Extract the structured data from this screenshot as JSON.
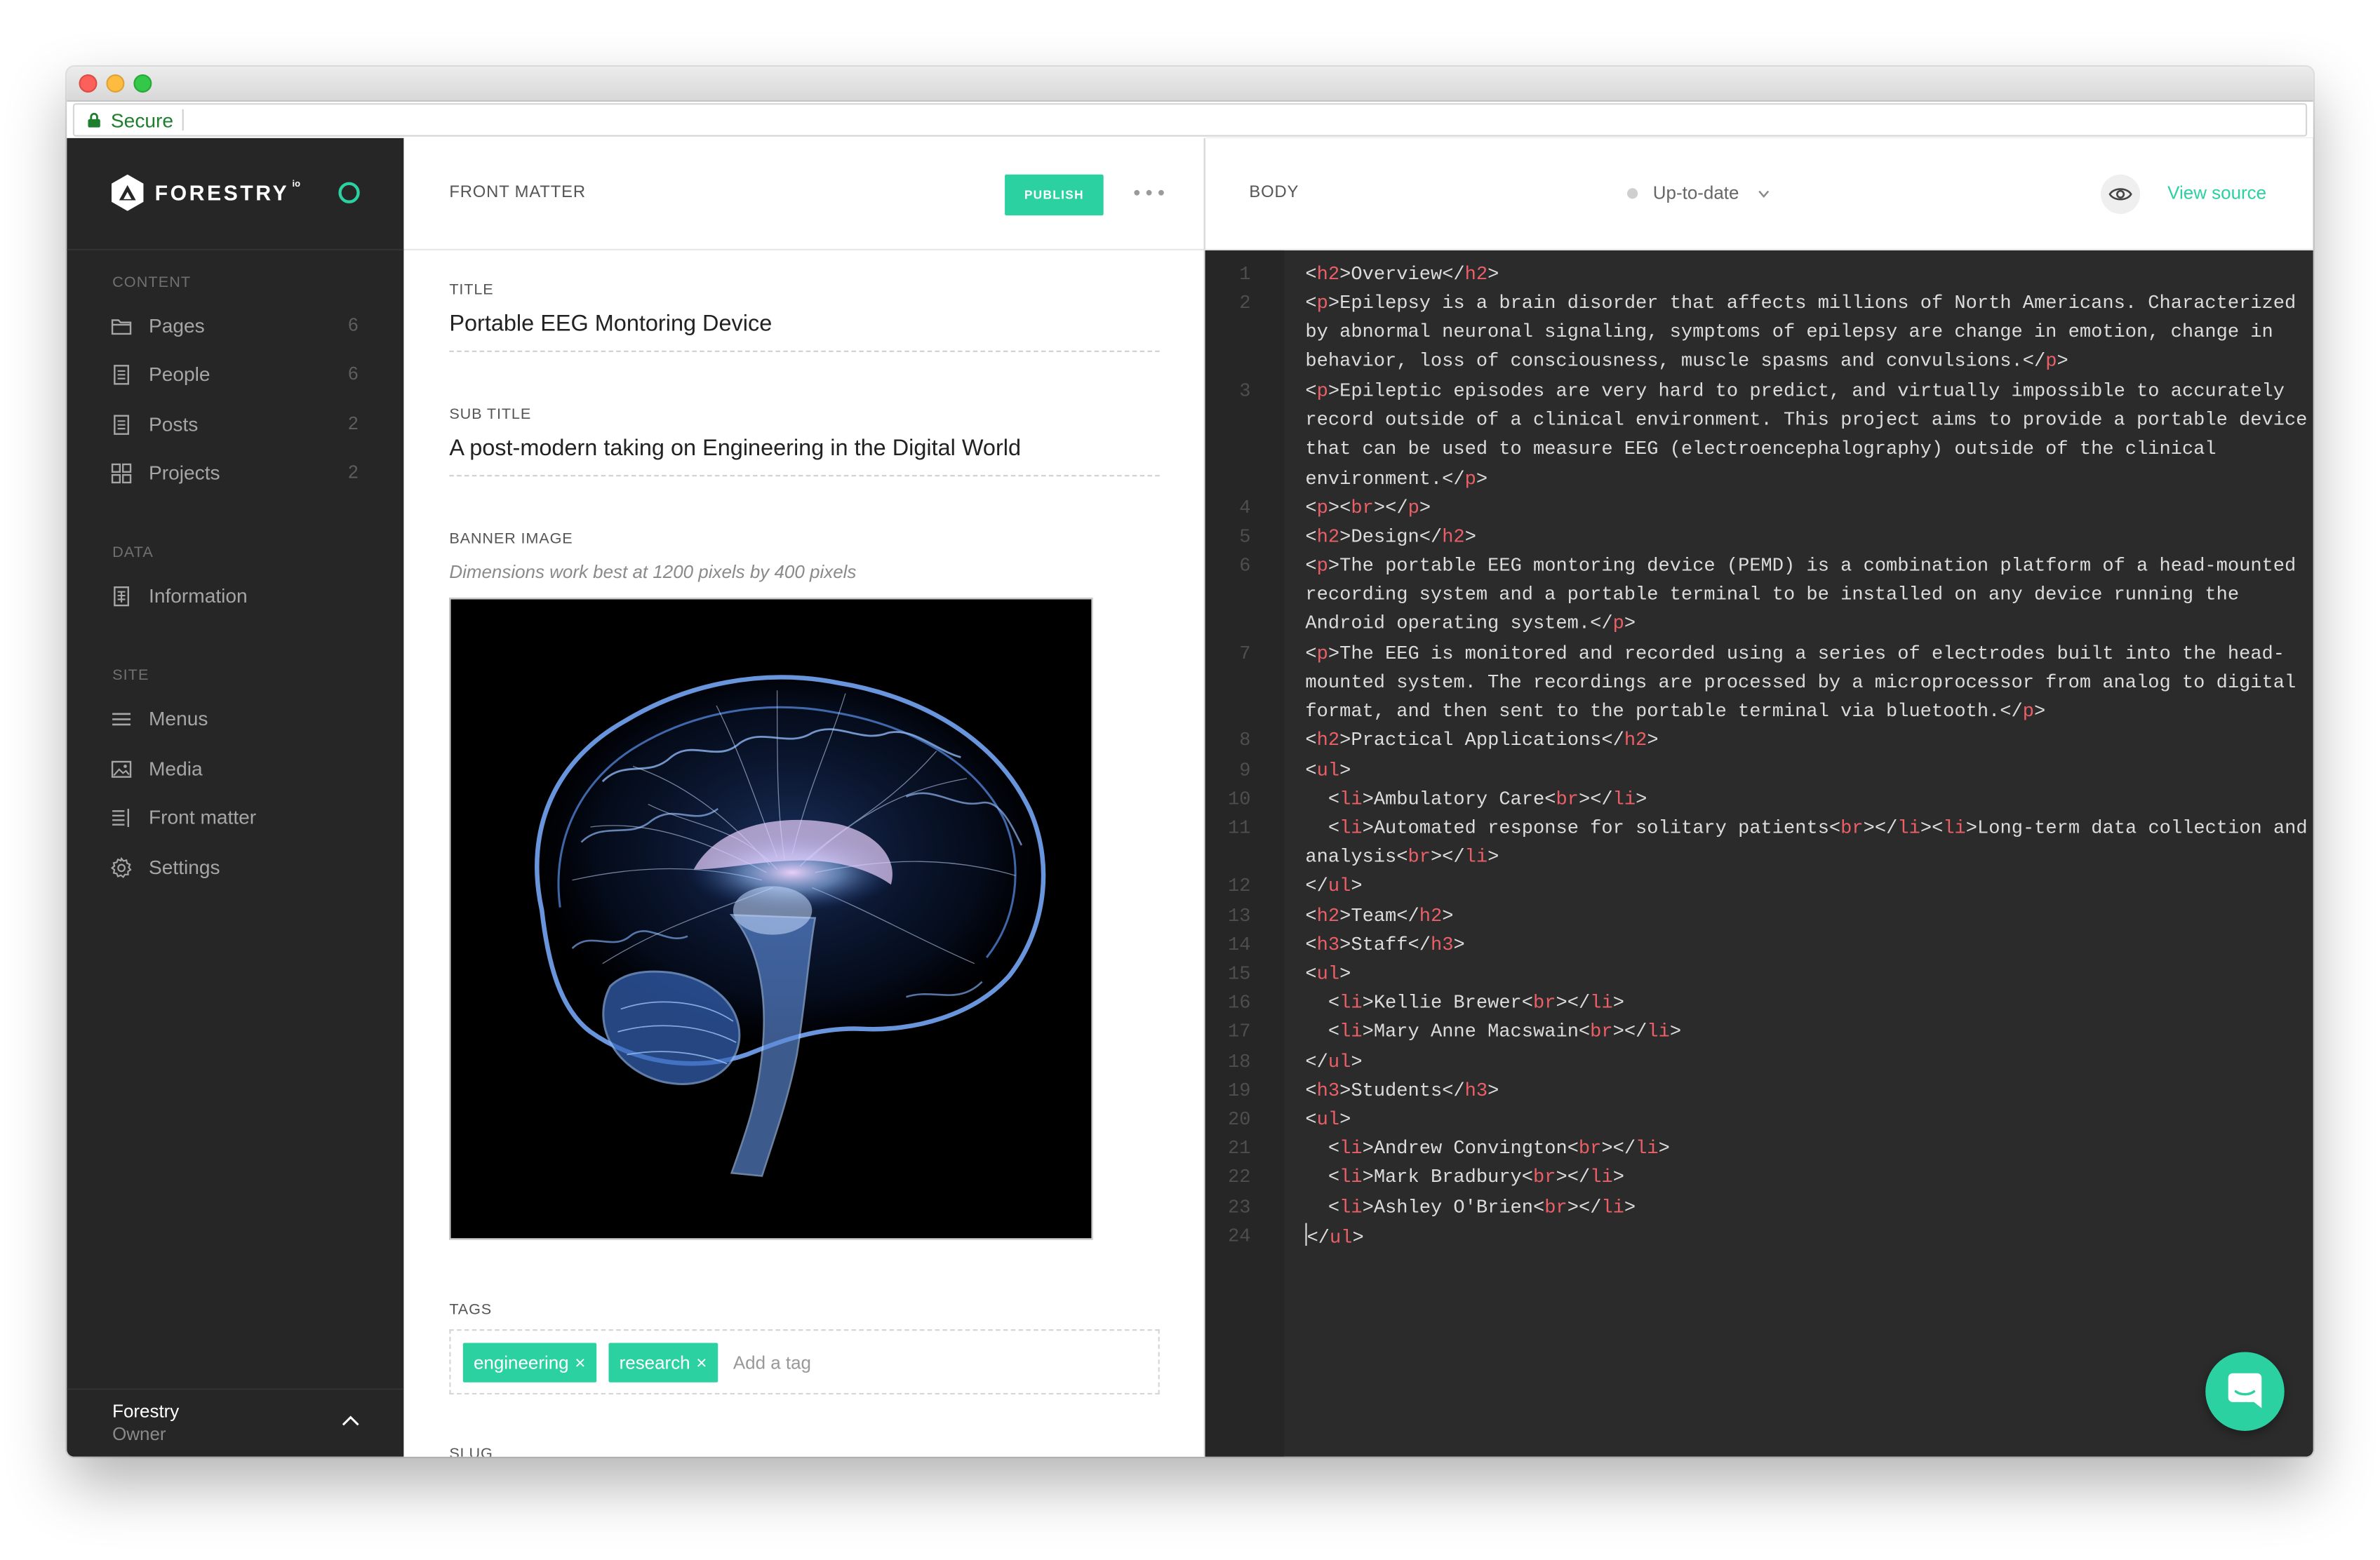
{
  "browser": {
    "secure_label": "Secure"
  },
  "sidebar": {
    "brand": "FORESTRY",
    "brand_suffix": "io",
    "sections": [
      {
        "label": "CONTENT",
        "items": [
          {
            "label": "Pages",
            "count": "6",
            "icon": "folder-icon"
          },
          {
            "label": "People",
            "count": "6",
            "icon": "document-icon"
          },
          {
            "label": "Posts",
            "count": "2",
            "icon": "document-icon"
          },
          {
            "label": "Projects",
            "count": "2",
            "icon": "grid-icon"
          }
        ]
      },
      {
        "label": "DATA",
        "items": [
          {
            "label": "Information",
            "icon": "data-file-icon"
          }
        ]
      },
      {
        "label": "SITE",
        "items": [
          {
            "label": "Menus",
            "icon": "menu-lines-icon"
          },
          {
            "label": "Media",
            "icon": "image-icon"
          },
          {
            "label": "Front matter",
            "icon": "list-icon"
          },
          {
            "label": "Settings",
            "icon": "gear-icon"
          }
        ]
      }
    ],
    "user": {
      "name": "Forestry",
      "role": "Owner"
    }
  },
  "front_matter": {
    "heading": "FRONT MATTER",
    "publish_label": "PUBLISH",
    "fields": {
      "title": {
        "label": "TITLE",
        "value": "Portable EEG Montoring Device"
      },
      "subtitle": {
        "label": "SUB TITLE",
        "value": "A post-modern taking on Engineering in the Digital World"
      },
      "banner": {
        "label": "BANNER IMAGE",
        "hint": "Dimensions work best at 1200 pixels by 400 pixels"
      },
      "tags": {
        "label": "TAGS",
        "values": [
          "engineering",
          "research"
        ],
        "placeholder": "Add a tag"
      },
      "slug": {
        "label": "SLUG"
      }
    }
  },
  "body": {
    "heading": "BODY",
    "status": "Up-to-date",
    "view_source_label": "View source"
  },
  "colors": {
    "accent": "#2bd1a1",
    "sidebar_bg": "#262626",
    "editor_bg": "#2b2b2b",
    "tag_syntax": "#ec5f67"
  }
}
